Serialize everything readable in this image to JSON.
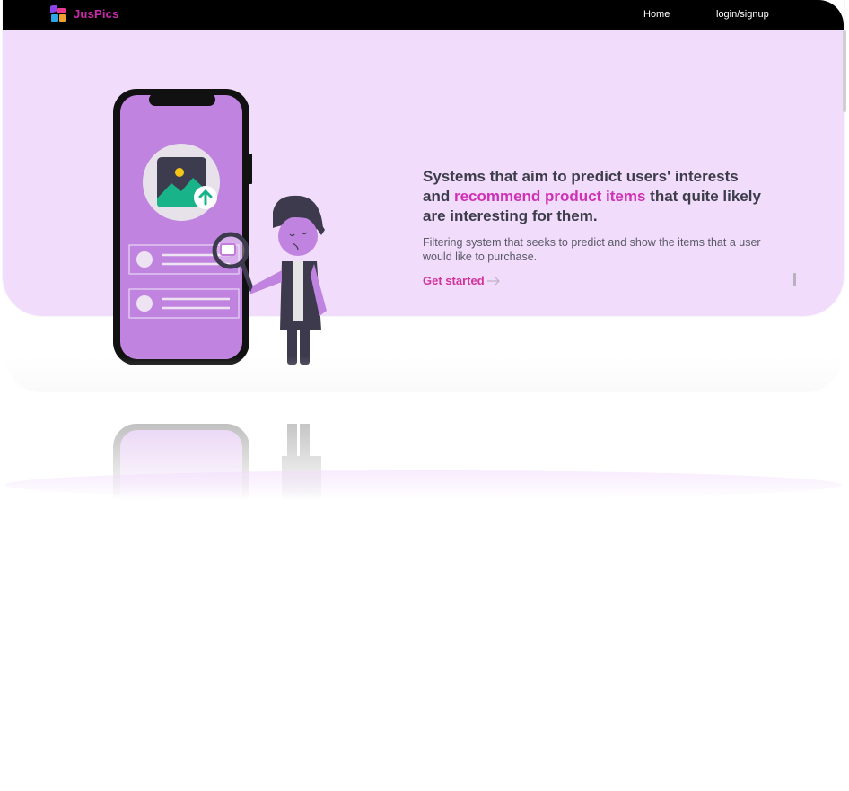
{
  "navbar": {
    "brand": "JusPics",
    "links": [
      {
        "label": "Home"
      },
      {
        "label": "login/signup"
      }
    ]
  },
  "hero": {
    "headline_part1": "Systems that aim to predict users' interests and ",
    "headline_accent": "recommend product items",
    "headline_part2": " that quite likely are interesting for them.",
    "subtext": "Filtering system that seeks to predict and show the items that a user would like to purchase.",
    "cta_label": "Get started",
    "cta_icon": "arrow-right-icon"
  },
  "colors": {
    "navbar_bg": "#000000",
    "hero_bg": "#f2dcfc",
    "brand": "#c92ba8",
    "accent": "#cf31b5",
    "cta": "#d1339a",
    "phone_screen": "#c084e0"
  }
}
